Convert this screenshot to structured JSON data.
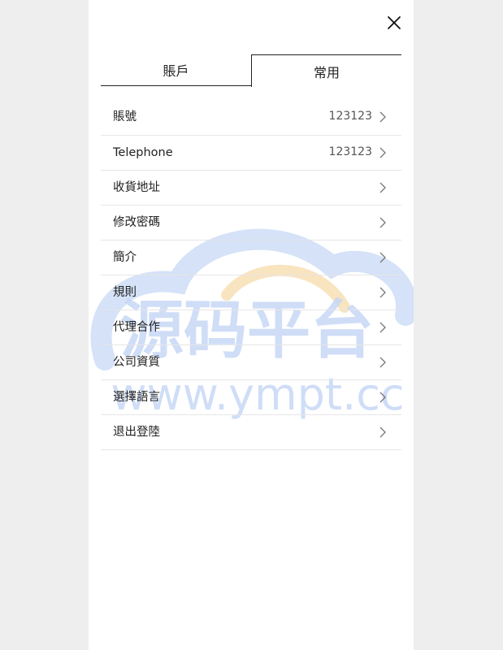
{
  "tabs": [
    {
      "label": "賬戶",
      "active": false
    },
    {
      "label": "常用",
      "active": true
    }
  ],
  "menu": [
    {
      "label": "賬號",
      "value": "123123"
    },
    {
      "label": "Telephone",
      "value": "123123"
    },
    {
      "label": "收貨地址",
      "value": ""
    },
    {
      "label": "修改密碼",
      "value": ""
    },
    {
      "label": "簡介",
      "value": ""
    },
    {
      "label": "規則",
      "value": ""
    },
    {
      "label": "代理合作",
      "value": ""
    },
    {
      "label": "公司資質",
      "value": ""
    },
    {
      "label": "選擇語言",
      "value": ""
    },
    {
      "label": "退出登陸",
      "value": ""
    }
  ],
  "watermark": {
    "title": "源码平台",
    "url": "www.ympt.cc"
  },
  "icons": {
    "close": "close-icon",
    "chevron": "chevron-right-icon"
  },
  "colors": {
    "background": "#eeeeee",
    "panel": "#ffffff",
    "divider": "#e6e6e6",
    "watermark_blue": "#c7d8f6",
    "watermark_orange": "#f8ddb0"
  }
}
